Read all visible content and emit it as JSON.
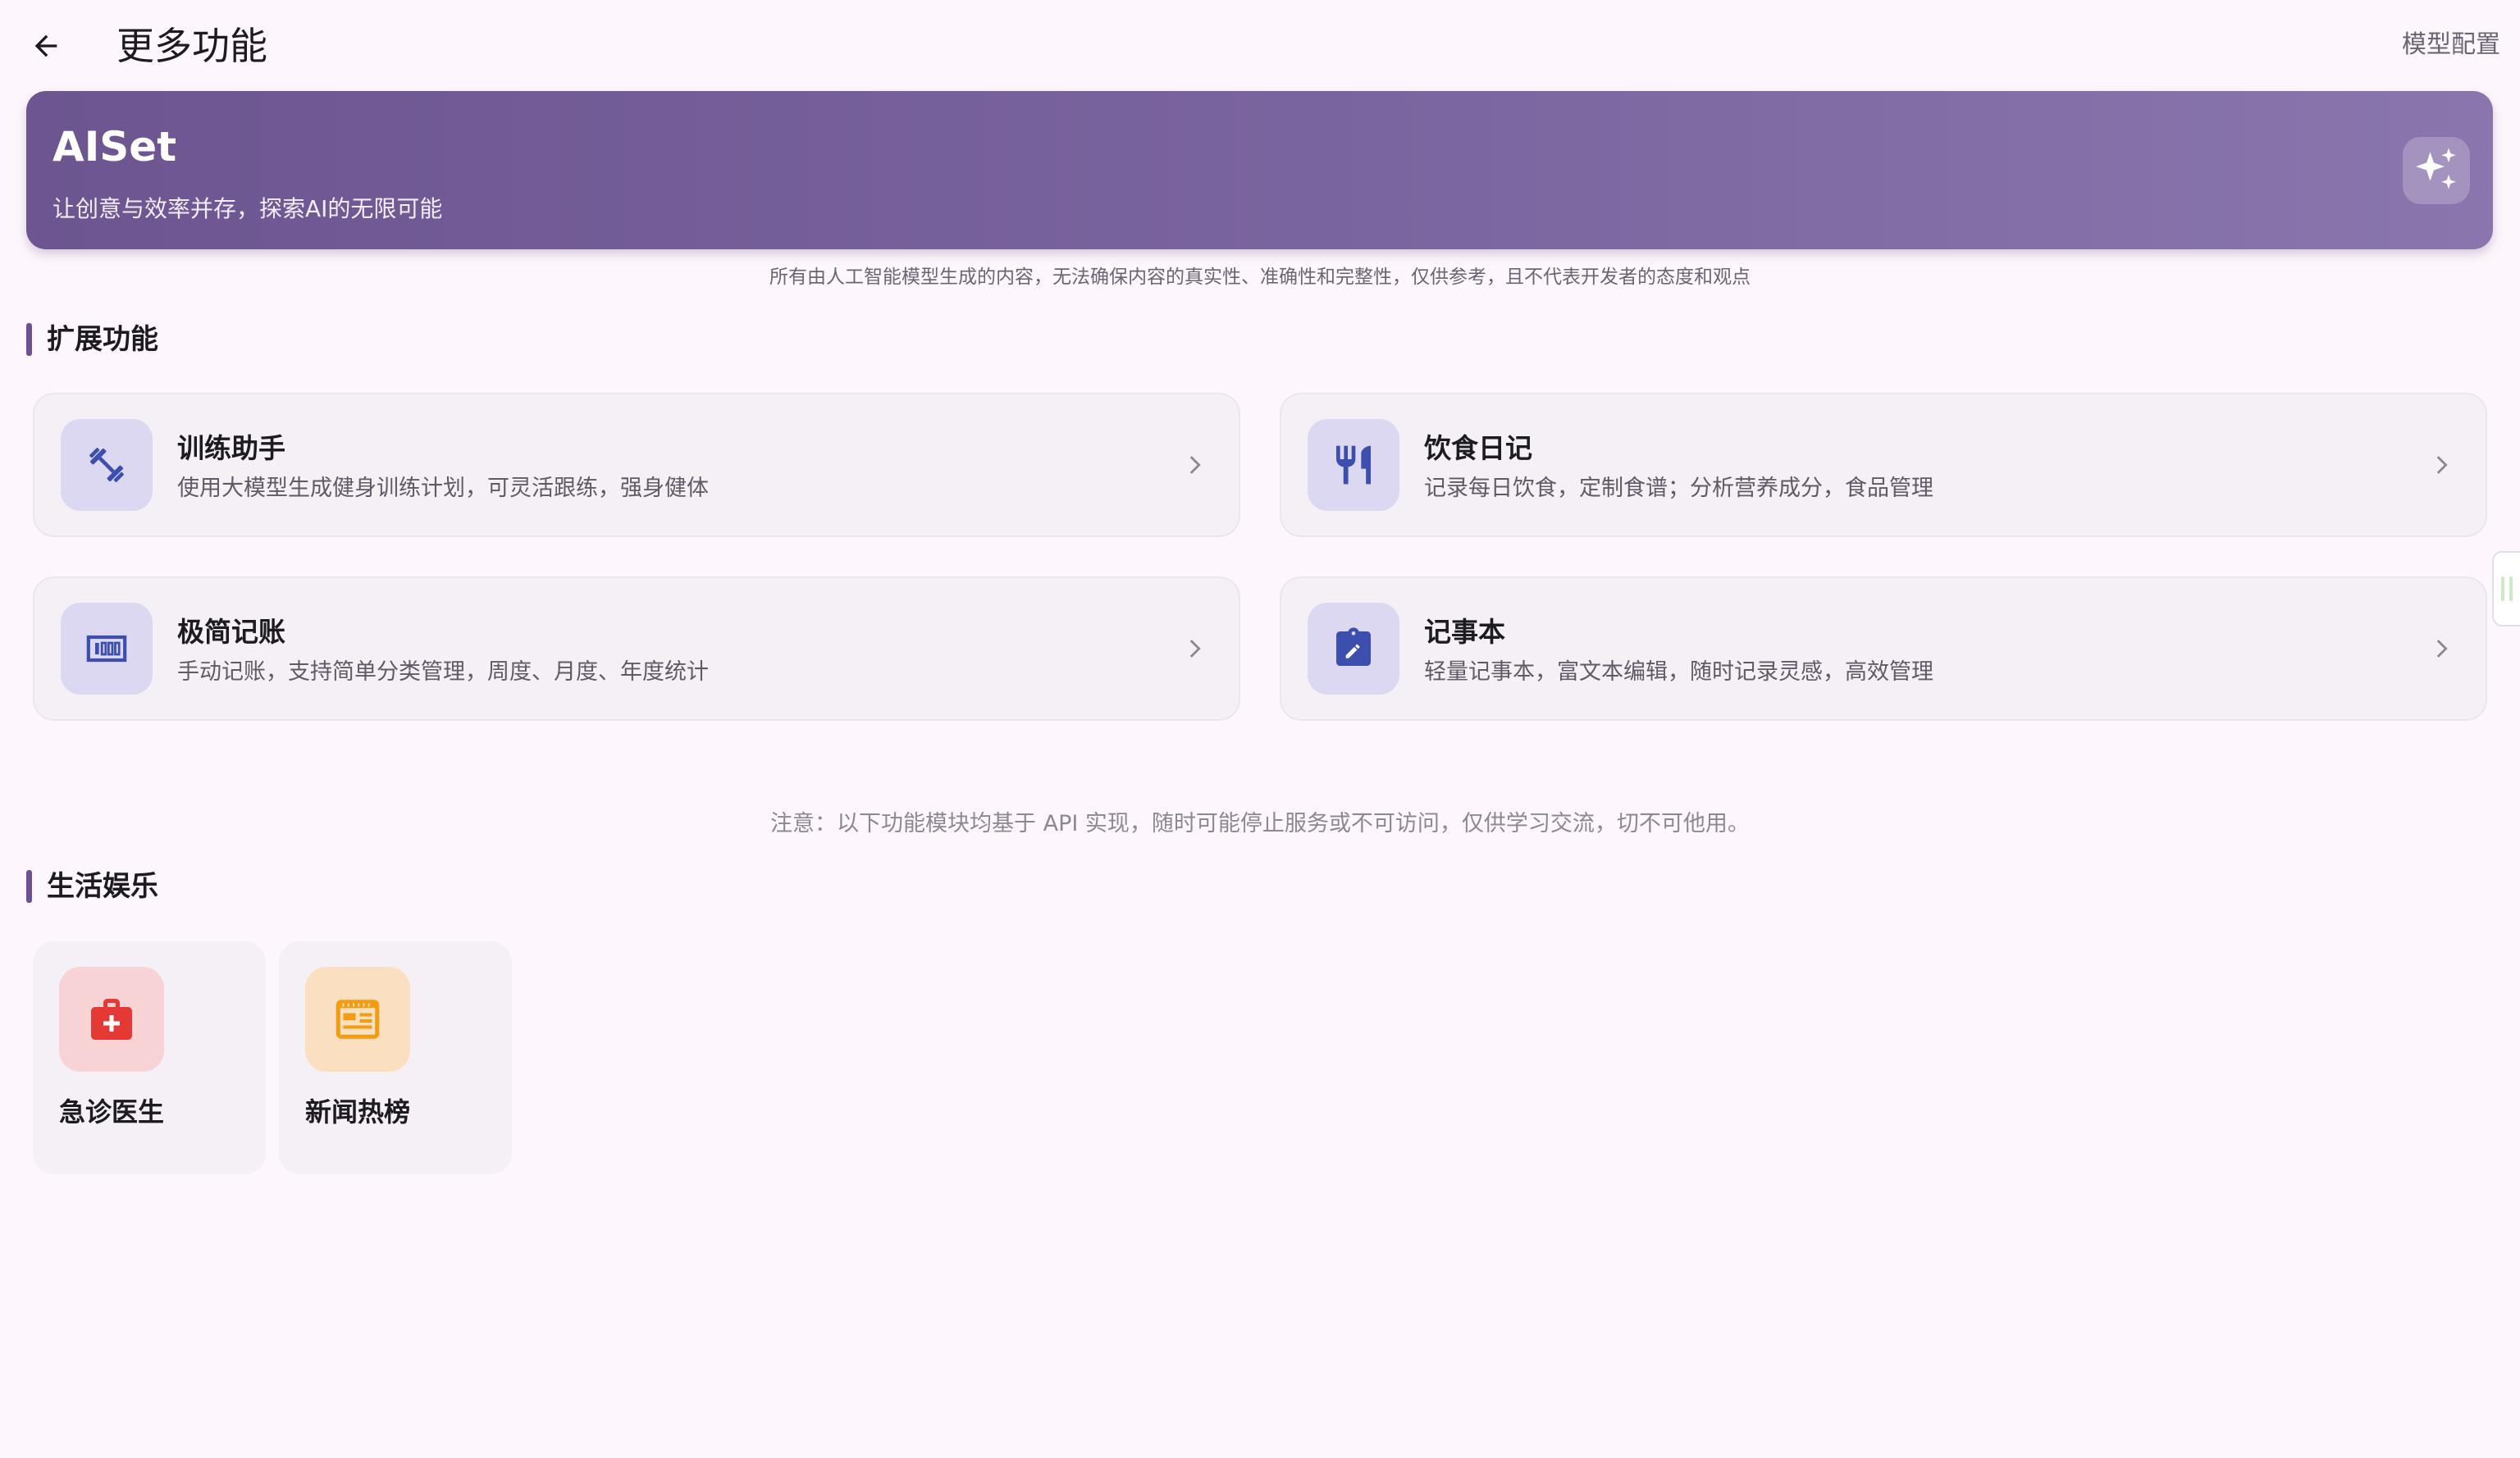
{
  "header": {
    "title": "更多功能",
    "right_action": "模型配置"
  },
  "banner": {
    "title": "AISet",
    "subtitle": "让创意与效率并存，探索AI的无限可能",
    "icon": "sparkles-icon"
  },
  "disclaimer": "所有由人工智能模型生成的内容，无法确保内容的真实性、准确性和完整性，仅供参考，且不代表开发者的态度和观点",
  "extensions": {
    "title": "扩展功能",
    "items": [
      {
        "title": "训练助手",
        "desc": "使用大模型生成健身训练计划，可灵活跟练，强身健体",
        "icon": "dumbbell-icon"
      },
      {
        "title": "饮食日记",
        "desc": "记录每日饮食，定制食谱；分析营养成分，食品管理",
        "icon": "fork-knife-icon"
      },
      {
        "title": "极简记账",
        "desc": "手动记账，支持简单分类管理，周度、月度、年度统计",
        "icon": "counter-icon"
      },
      {
        "title": "记事本",
        "desc": "轻量记事本，富文本编辑，随时记录灵感，高效管理",
        "icon": "clipboard-edit-icon"
      }
    ]
  },
  "notice": "注意：以下功能模块均基于 API 实现，随时可能停止服务或不可访问，仅供学习交流，切不可他用。",
  "life": {
    "title": "生活娱乐",
    "items": [
      {
        "label": "急诊医生",
        "icon": "medical-kit-icon",
        "bg": "#f8d3d6",
        "color": "#e53935"
      },
      {
        "label": "新闻热榜",
        "icon": "newspaper-icon",
        "bg": "#fbdfc1",
        "color": "#f39c12"
      }
    ]
  },
  "colors": {
    "accent": "#6d4f95",
    "card_icon_bg": "#dcd8f1",
    "card_icon_fg": "#3c4fae"
  }
}
